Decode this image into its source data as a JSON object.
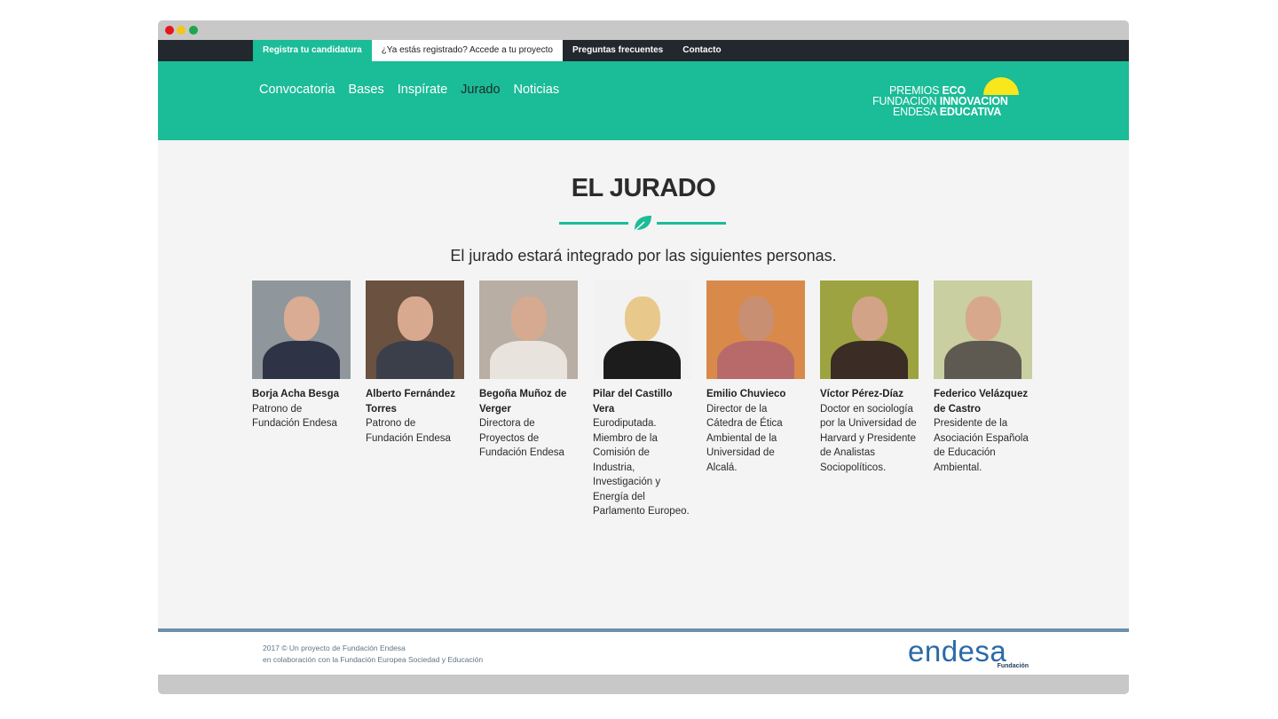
{
  "topnav": {
    "register": "Registra tu candidatura",
    "login": "¿Ya estás registrado? Accede a tu proyecto",
    "faq": "Preguntas frecuentes",
    "contact": "Contacto"
  },
  "mainnav": {
    "convocatoria": "Convocatoria",
    "bases": "Bases",
    "inspirate": "Inspírate",
    "jurado": "Jurado",
    "noticias": "Noticias"
  },
  "logo": {
    "r1a": "PREMIOS",
    "r1b": "ECO",
    "r2a": "FUNDACION",
    "r2b": "INNOVACION",
    "r3a": "ENDESA",
    "r3b": "EDUCATIVA"
  },
  "page": {
    "title": "EL JURADO",
    "subtitle": "El jurado estará integrado por las siguientes personas."
  },
  "jury": [
    {
      "name": "Borja Acha Besga",
      "role": "Patrono de Fundación Endesa"
    },
    {
      "name": "Alberto Fernández Torres",
      "role": "Patrono de Fundación Endesa"
    },
    {
      "name": "Begoña Muñoz de Verger",
      "role": "Directora de Proyectos de Fundación Endesa"
    },
    {
      "name": "Pilar del Castillo Vera",
      "role": "Eurodiputada. Miembro de la Comisión de Industria, Investigación y Energía del Parlamento Europeo."
    },
    {
      "name": "Emilio Chuvieco",
      "role": "Director de la Cátedra de Ética Ambiental de la Universidad de Alcalá."
    },
    {
      "name": "Víctor Pérez-Díaz",
      "role": "Doctor en sociología por la Universidad de Harvard y Presidente de Analistas Sociopolíticos."
    },
    {
      "name": "Federico Velázquez de Castro",
      "role": "Presidente de la Asociación Española de Educación Ambiental."
    }
  ],
  "footer": {
    "line1": "2017 © Un proyecto de Fundación Endesa",
    "line2": "en colaboración con la Fundación Europea Sociedad y Educación",
    "brand": "endesa",
    "brand_sub": "Fundación"
  },
  "colors": {
    "accent": "#1bbc98",
    "dark_bar": "#23272e",
    "footer_line": "#6e8fa8"
  }
}
